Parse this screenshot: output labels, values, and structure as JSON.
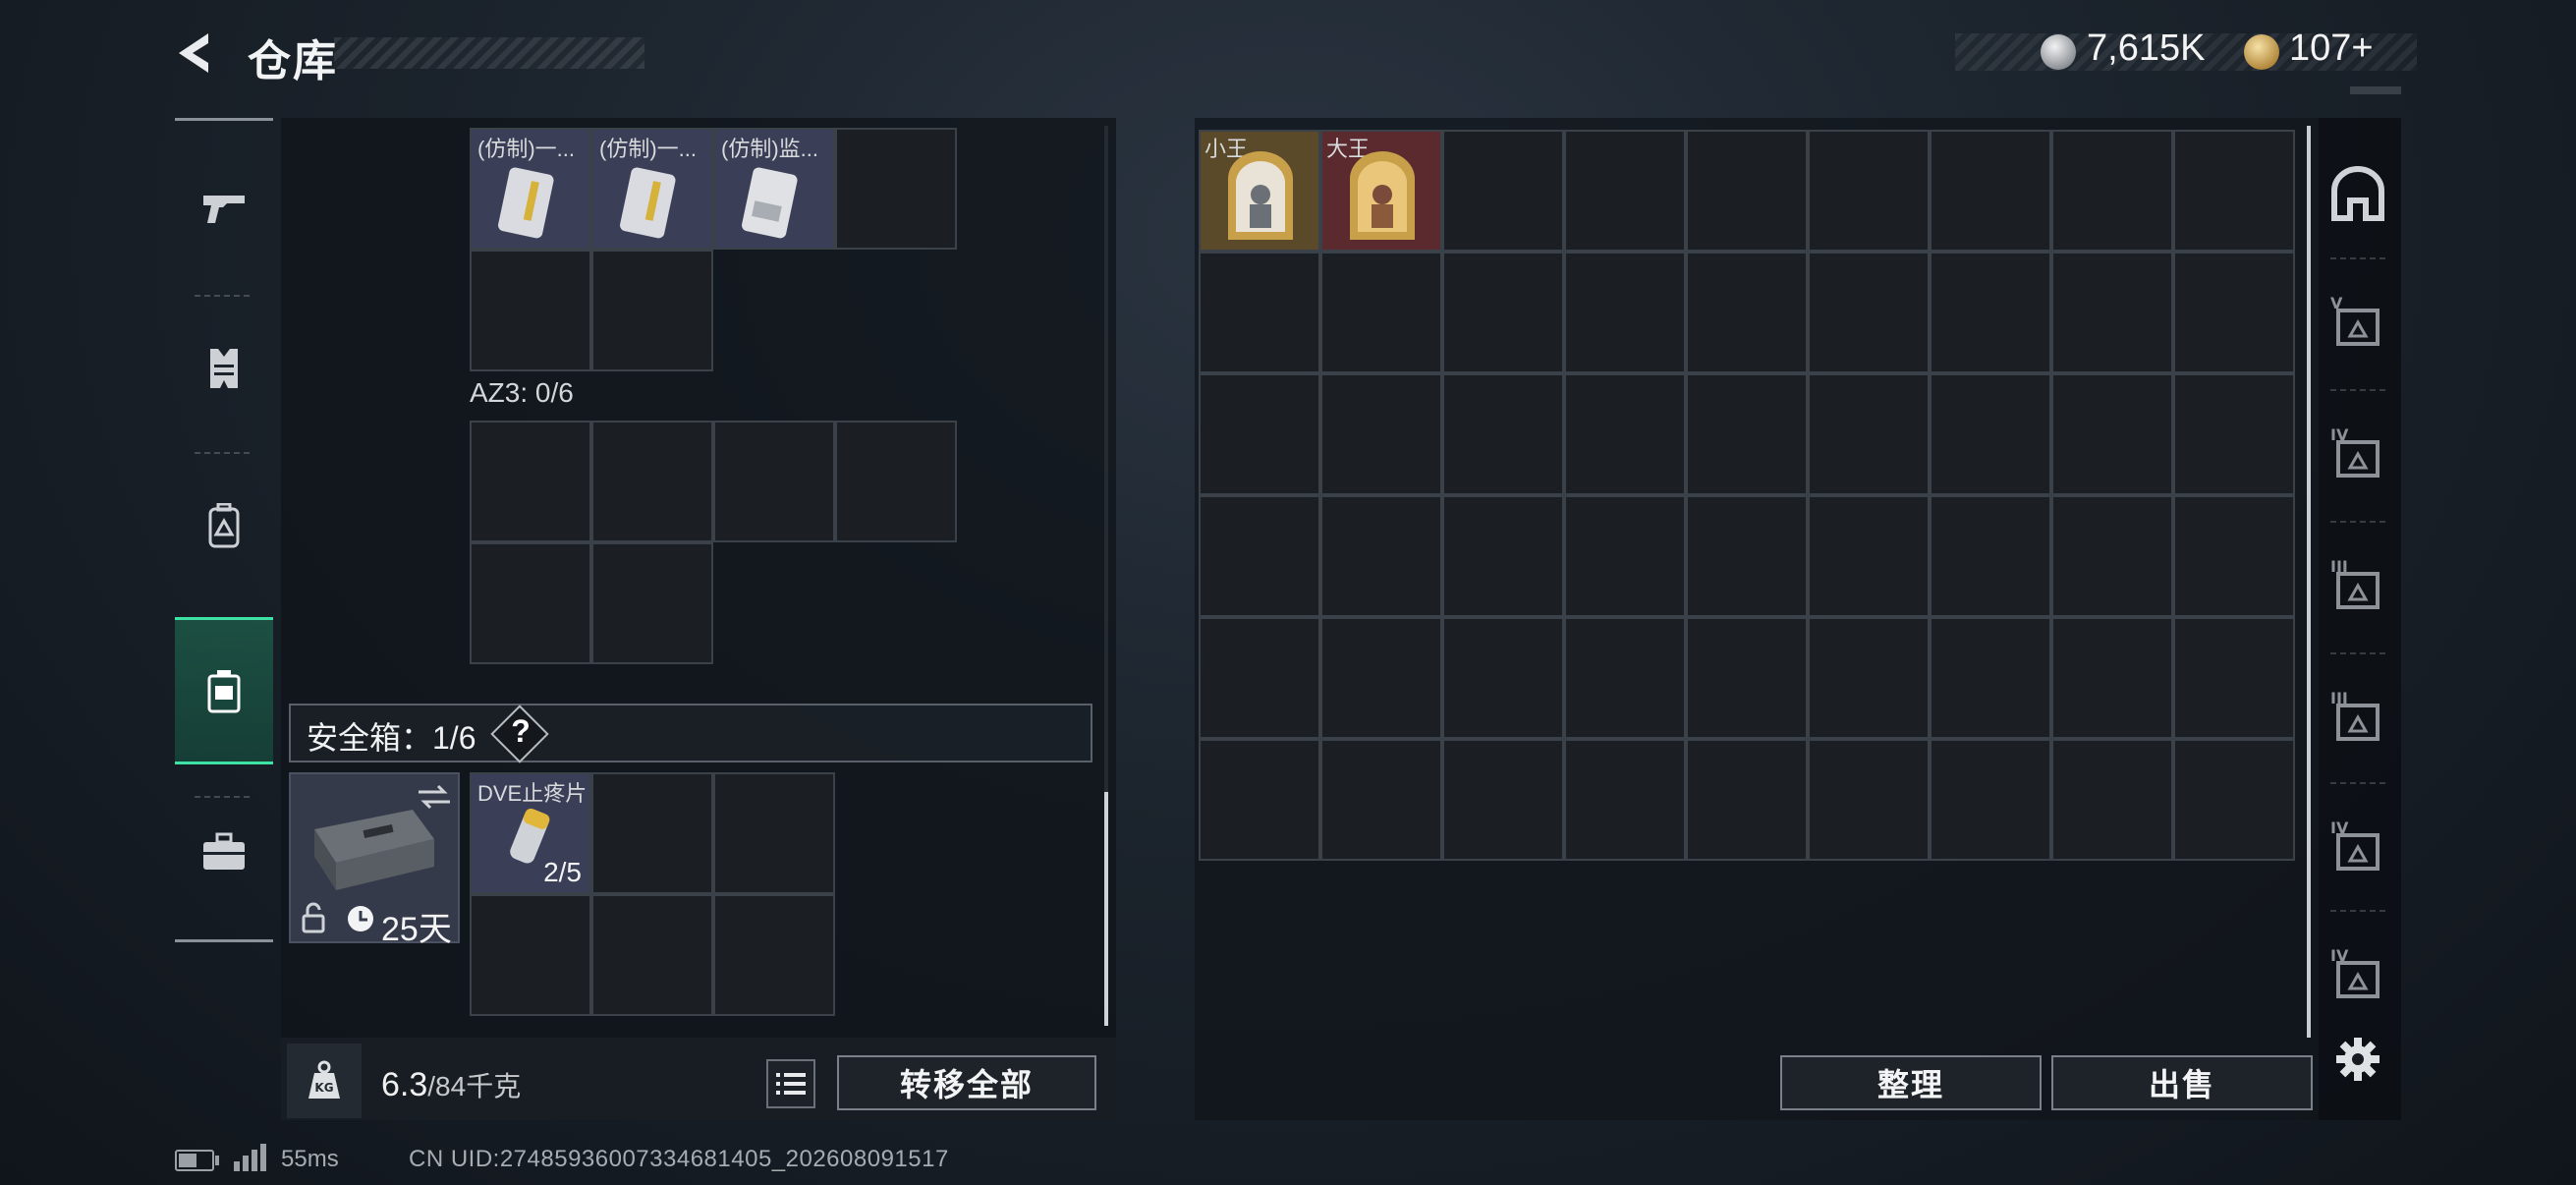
{
  "header": {
    "title": "仓库",
    "silver_amount": "7,615K",
    "gold_amount": "107+"
  },
  "rail": {
    "items": [
      {
        "name": "weapons",
        "icon": "pistol-icon"
      },
      {
        "name": "armor",
        "icon": "vest-icon"
      },
      {
        "name": "backpack",
        "icon": "backpack-icon"
      },
      {
        "name": "containers",
        "icon": "container-icon",
        "active": true
      },
      {
        "name": "case",
        "icon": "briefcase-icon"
      }
    ]
  },
  "left": {
    "items_top": [
      "(仿制)一...",
      "(仿制)一...",
      "(仿制)监..."
    ],
    "az3_label": "AZ3: 0/6",
    "safe_label": "安全箱：1/6",
    "help_label": "?",
    "safe_case_days": "25天",
    "safe_item_label": "DVE止疼片",
    "safe_item_count": "2/5",
    "weight_value": "6.3",
    "weight_max": "/84千克",
    "transfer_label": "转移全部"
  },
  "right": {
    "items": [
      "小王",
      "大王"
    ],
    "sort_label": "整理",
    "sell_label": "出售",
    "side_tabs": [
      {
        "icon": "dome-icon",
        "tier": ""
      },
      {
        "icon": "v-chest-icon",
        "tier": "V"
      },
      {
        "icon": "medkit-icon",
        "tier": "IV"
      },
      {
        "icon": "armor-triangle-icon",
        "tier": "III"
      },
      {
        "icon": "armor-triangle-icon",
        "tier": "III"
      },
      {
        "icon": "ammo-box-icon",
        "tier": "IV"
      },
      {
        "icon": "truck-icon",
        "tier": "IV"
      }
    ]
  },
  "status": {
    "ping": "55ms",
    "uid": "CN UID:27485936007334681405_202608091517"
  }
}
